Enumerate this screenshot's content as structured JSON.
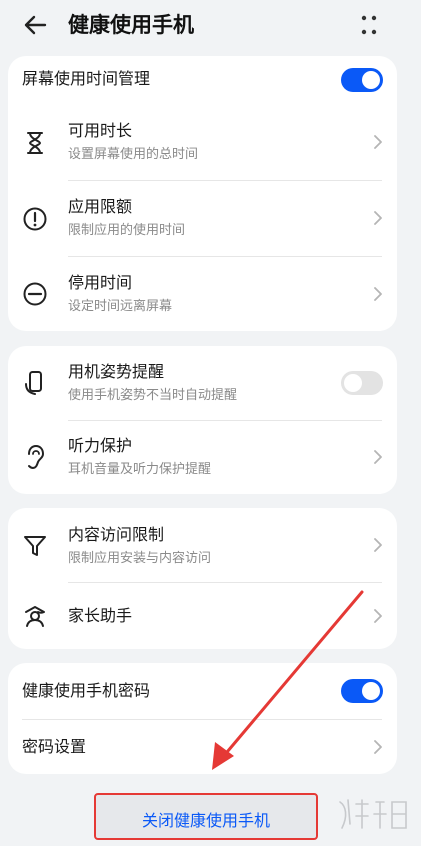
{
  "header": {
    "title": "健康使用手机",
    "back_icon": "arrow-left-icon",
    "more_icon": "more-grid-icon"
  },
  "card1": {
    "toggle_row": {
      "label": "屏幕使用时间管理",
      "enabled": true
    },
    "rows": [
      {
        "title": "可用时长",
        "subtitle": "设置屏幕使用的总时间",
        "icon": "hourglass-icon"
      },
      {
        "title": "应用限额",
        "subtitle": "限制应用的使用时间",
        "icon": "alert-circle-icon"
      },
      {
        "title": "停用时间",
        "subtitle": "设定时间远离屏幕",
        "icon": "minus-circle-icon"
      }
    ]
  },
  "card2": {
    "rows": [
      {
        "title": "用机姿势提醒",
        "subtitle": "使用手机姿势不当时自动提醒",
        "icon": "phone-posture-icon",
        "enabled": false
      },
      {
        "title": "听力保护",
        "subtitle": "耳机音量及听力保护提醒",
        "icon": "ear-icon"
      }
    ]
  },
  "card3": {
    "rows": [
      {
        "title": "内容访问限制",
        "subtitle": "限制应用安装与内容访问",
        "icon": "filter-icon"
      },
      {
        "title": "家长助手",
        "icon": "parent-assistant-icon"
      }
    ]
  },
  "card4": {
    "password_toggle": {
      "label": "健康使用手机密码",
      "enabled": true
    },
    "password_settings": {
      "label": "密码设置"
    }
  },
  "bottom_button": {
    "label": "关闭健康使用手机"
  },
  "colors": {
    "accent": "#0a59f7",
    "background": "#f1f3f5",
    "annotation_red": "#e53935"
  }
}
